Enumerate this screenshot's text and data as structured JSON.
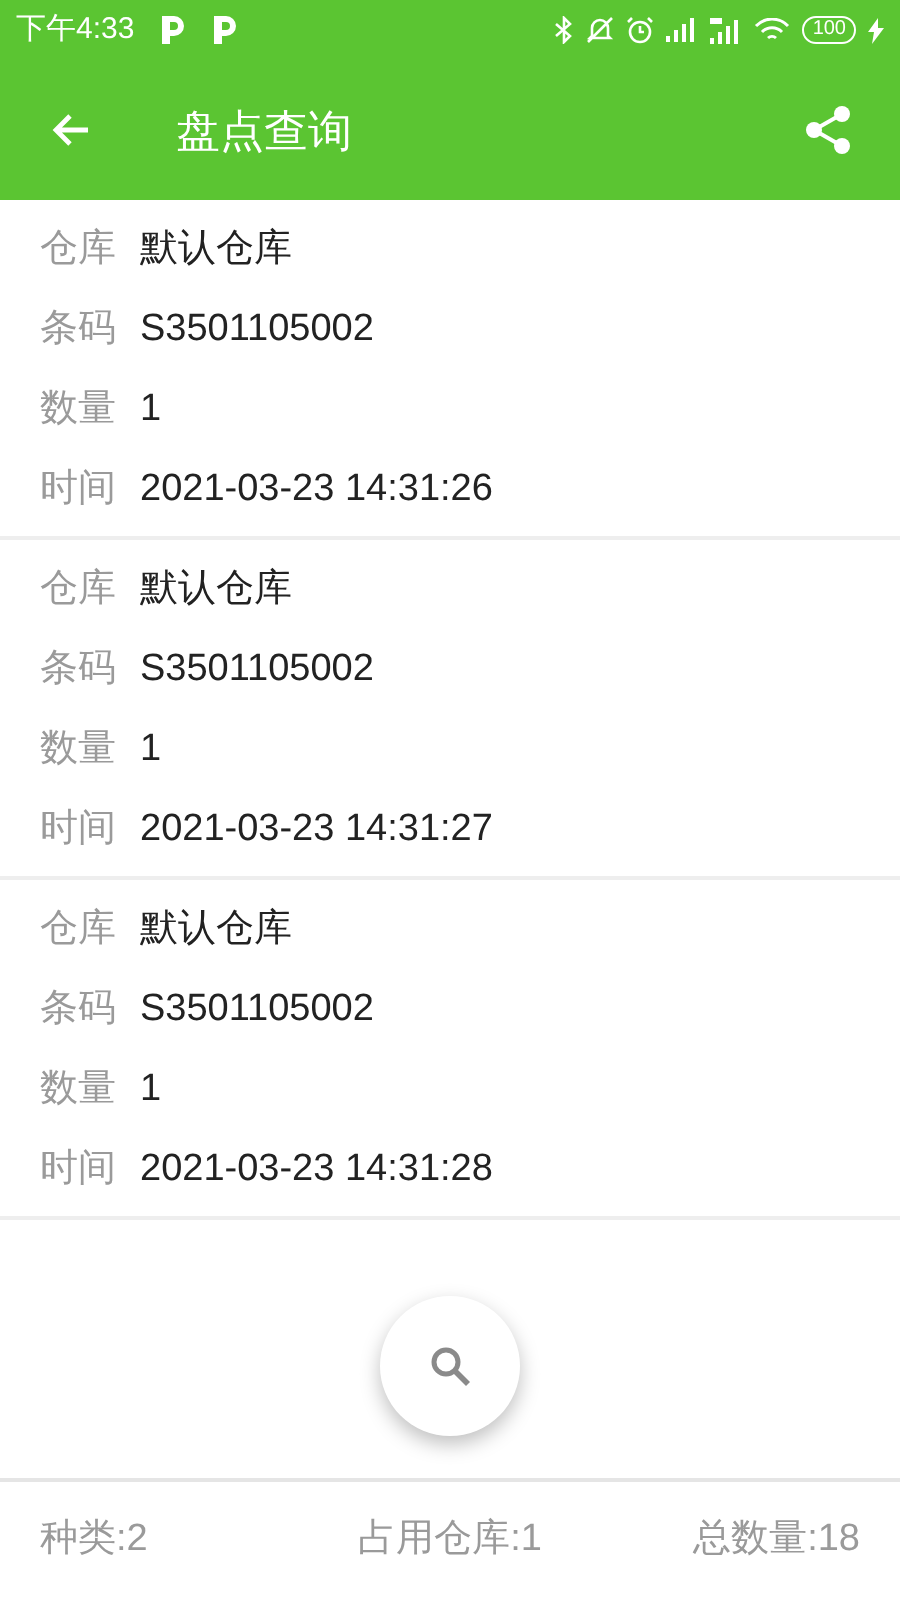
{
  "status_bar": {
    "time": "下午4:33",
    "battery": "100"
  },
  "toolbar": {
    "title": "盘点查询"
  },
  "records": [
    {
      "fields": [
        {
          "label": "仓库",
          "value": "默认仓库"
        },
        {
          "label": "条码",
          "value": "S3501105002"
        },
        {
          "label": "数量",
          "value": "1"
        },
        {
          "label": "时间",
          "value": "2021-03-23 14:31:26"
        }
      ]
    },
    {
      "fields": [
        {
          "label": "仓库",
          "value": "默认仓库"
        },
        {
          "label": "条码",
          "value": "S3501105002"
        },
        {
          "label": "数量",
          "value": "1"
        },
        {
          "label": "时间",
          "value": "2021-03-23 14:31:27"
        }
      ]
    },
    {
      "fields": [
        {
          "label": "仓库",
          "value": "默认仓库"
        },
        {
          "label": "条码",
          "value": "S3501105002"
        },
        {
          "label": "数量",
          "value": "1"
        },
        {
          "label": "时间",
          "value": "2021-03-23 14:31:28"
        }
      ]
    }
  ],
  "summary": [
    "种类:2",
    "占用仓库:1",
    "总数量:18"
  ]
}
